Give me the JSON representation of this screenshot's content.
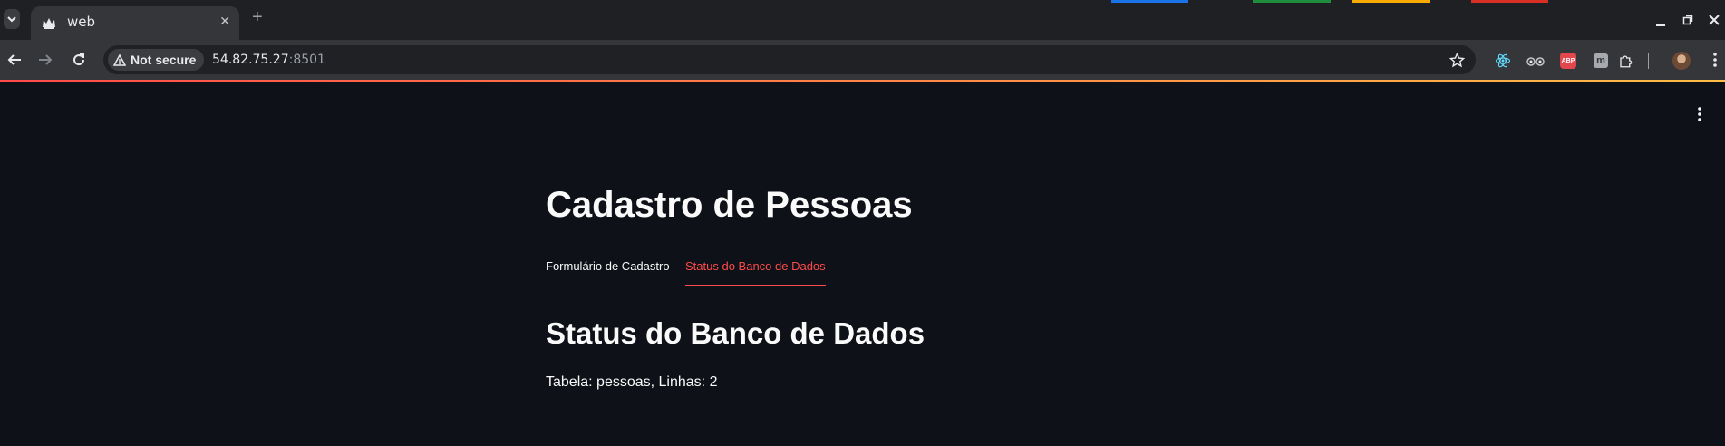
{
  "browser": {
    "tab_title": "web",
    "tab_close": "✕",
    "new_tab": "+",
    "security_label": "Not secure",
    "url_host": "54.82.75.27",
    "url_port": ":8501",
    "accent_colors": [
      "#ff4b4b",
      "#ffbd45"
    ]
  },
  "app": {
    "title": "Cadastro de Pessoas",
    "tabs": [
      {
        "label": "Formulário de Cadastro",
        "active": false
      },
      {
        "label": "Status do Banco de Dados",
        "active": true
      }
    ],
    "section_title": "Status do Banco de Dados",
    "status_text": "Tabela: pessoas, Linhas: 2",
    "active_color": "#ff4b4b"
  },
  "icons": {
    "tab_search": "chevron-down-icon",
    "back": "arrow-left-icon",
    "forward": "arrow-right-icon",
    "reload": "reload-icon",
    "security": "warning-triangle-icon",
    "bookmark": "star-icon",
    "extensions": [
      "react-devtools-icon",
      "glasses-extension-icon",
      "adblock-plus-icon",
      "m-extension-icon",
      "puzzle-icon"
    ],
    "menu": "kebab-menu-icon"
  }
}
